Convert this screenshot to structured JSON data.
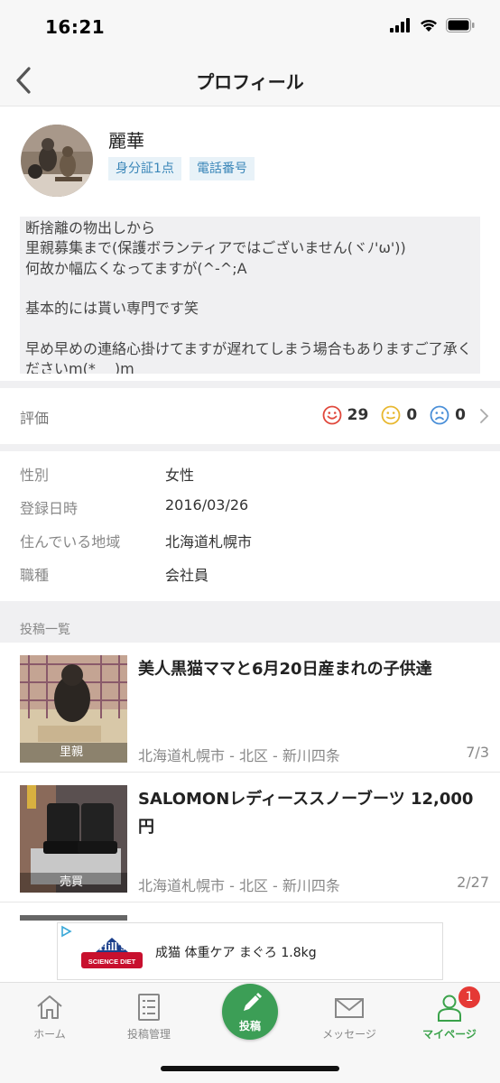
{
  "status_bar": {
    "time": "16:21"
  },
  "nav": {
    "title": "プロフィール"
  },
  "profile": {
    "name": "麗華",
    "badges": [
      "身分証1点",
      "電話番号"
    ],
    "bio": "断捨離の物出しから\n里親募集まで(保護ボランティアではございません(ヾﾉ'ω'))\n何故か幅広くなってますが(^-^;A\n\n基本的には貰い専門です笑\n\n早め早めの連絡心掛けてますが遅れてしまう場合もありますご了承くださいm(*_ _)m"
  },
  "rating": {
    "label": "評価",
    "good": "29",
    "neutral": "0",
    "bad": "0",
    "colors": {
      "good": "#e0483c",
      "neutral": "#e8b830",
      "bad": "#4a8fd8"
    }
  },
  "info": {
    "rows": [
      {
        "key": "性別",
        "value": "女性"
      },
      {
        "key": "登録日時",
        "value": "2016/03/26"
      },
      {
        "key": "住んでいる地域",
        "value": "北海道札幌市"
      },
      {
        "key": "職種",
        "value": "会社員"
      }
    ]
  },
  "posts": {
    "header": "投稿一覧",
    "items": [
      {
        "title": "美人黒猫ママと6月20日産まれの子供達",
        "tag": "里親",
        "location": "北海道札幌市 - 北区 - 新川四条",
        "date": "7/3"
      },
      {
        "title": "SALOMONレディーススノーブーツ 12,000円",
        "tag": "売買",
        "location": "北海道札幌市 - 北区 - 新川四条",
        "date": "2/27"
      }
    ]
  },
  "ad": {
    "brand_top": "Hill's",
    "brand_bottom": "SCIENCE DIET",
    "text": "成猫 体重ケア まぐろ 1.8kg"
  },
  "tabbar": {
    "home": "ホーム",
    "manage": "投稿管理",
    "post": "投稿",
    "messages": "メッセージ",
    "mypage": "マイページ",
    "badge_count": "1",
    "active_color": "#3aa24a"
  }
}
